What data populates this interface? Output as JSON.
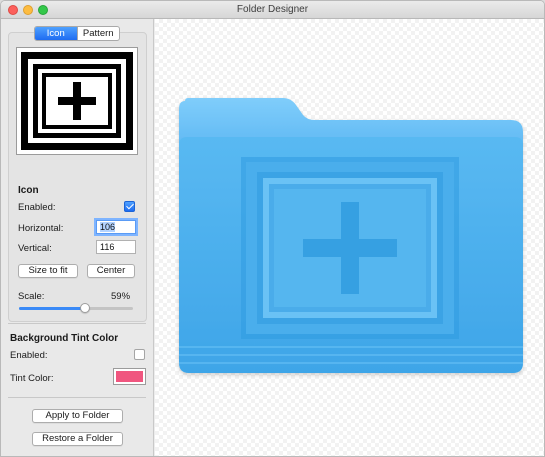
{
  "window": {
    "title": "Folder Designer"
  },
  "tabs": [
    {
      "label": "Icon",
      "active": true
    },
    {
      "label": "Pattern",
      "active": false
    }
  ],
  "icon_section": {
    "heading": "Icon",
    "enabled_label": "Enabled:",
    "enabled": true,
    "horizontal_label": "Horizontal:",
    "horizontal_value": "106",
    "vertical_label": "Vertical:",
    "vertical_value": "116",
    "size_to_fit_label": "Size to fit",
    "center_label": "Center",
    "scale_label": "Scale:",
    "scale_value_text": "59%",
    "scale_fraction": 0.59
  },
  "tint_section": {
    "heading": "Background Tint Color",
    "enabled_label": "Enabled:",
    "enabled": false,
    "tint_label": "Tint Color:",
    "tint_color": "#f0567f"
  },
  "actions": {
    "apply_label": "Apply to Folder",
    "restore_label": "Restore a Folder"
  },
  "colors": {
    "accent": "#1e6cf1",
    "folder_back": "#6fc2f7",
    "folder_front": "#4aaeec",
    "emboss_dark": "#2f9be0",
    "emboss_light": "#8fd2fb"
  },
  "icons": {
    "preview": "plus-in-frame-icon",
    "traffic_lights": [
      "close-window-icon",
      "minimize-window-icon",
      "zoom-window-icon"
    ]
  }
}
